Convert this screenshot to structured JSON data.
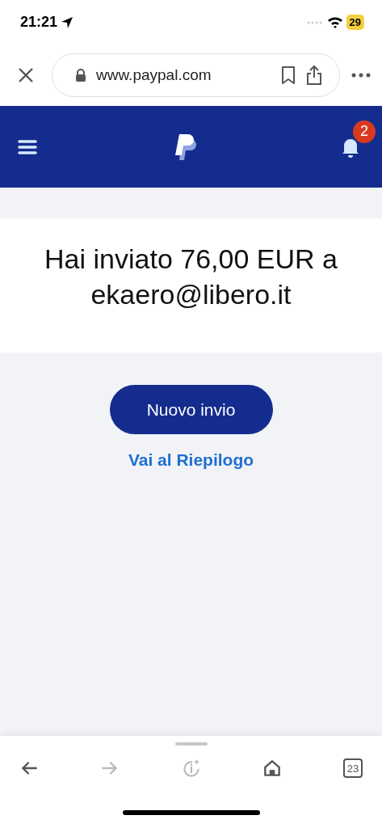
{
  "status_bar": {
    "time": "21:21",
    "battery": "29"
  },
  "browser": {
    "url": "www.paypal.com"
  },
  "header": {
    "notification_count": "2"
  },
  "confirmation": {
    "message": "Hai inviato 76,00 EUR a ekaero@libero.it"
  },
  "actions": {
    "primary_button": "Nuovo invio",
    "link": "Vai al Riepilogo"
  },
  "toolbar": [
    {
      "kind": "back",
      "disabled": false
    },
    {
      "kind": "forward",
      "disabled": true
    },
    {
      "kind": "info",
      "disabled": true
    },
    {
      "kind": "home",
      "disabled": false
    },
    {
      "kind": "tabs",
      "label": "23",
      "disabled": false
    }
  ]
}
